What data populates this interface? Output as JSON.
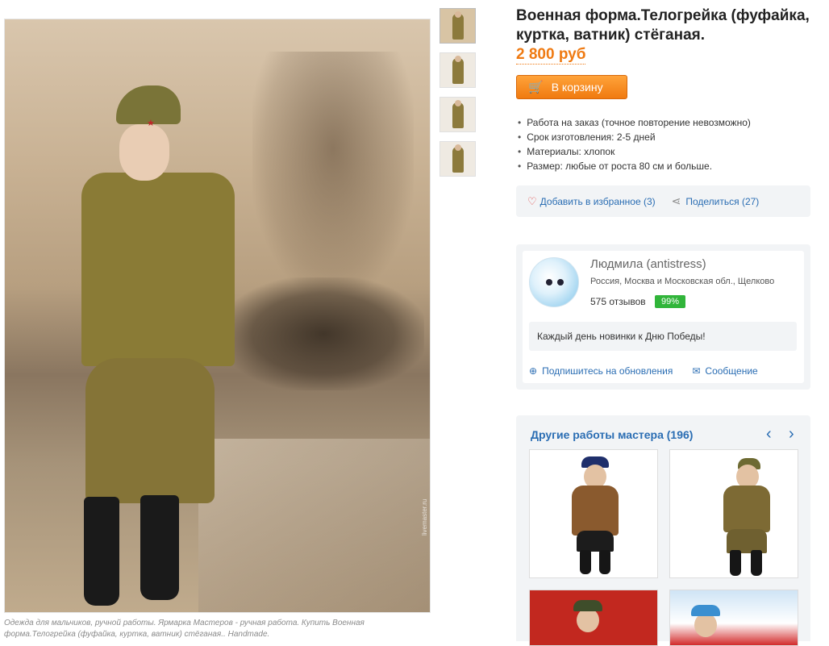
{
  "product": {
    "title": "Военная форма.Телогрейка (фуфайка, куртка, ватник) стёганая.",
    "price": "2 800 руб",
    "cart_button": "В корзину",
    "details": [
      "Работа на заказ  (точное повторение невозможно)",
      "Срок изготовления: 2-5 дней",
      "Материалы: хлопок",
      "Размер: любые от роста 80 см и больше."
    ],
    "favorite_label": "Добавить в избранное (3)",
    "share_label": "Поделиться (27)",
    "caption": "Одежда для мальчиков, ручной работы. Ярмарка Мастеров - ручная работа. Купить Военная форма.Телогрейка (фуфайка, куртка, ватник) стёганая.. Handmade.",
    "watermark": "livemaster.ru"
  },
  "seller": {
    "name": "Людмила (antistress)",
    "location": "Россия, Москва и Московская обл., Щелково",
    "reviews": "575 отзывов",
    "rating": "99%",
    "note": "Каждый день новинки к Дню Победы!",
    "subscribe": "Подпишитесь на обновления",
    "message": "Сообщение"
  },
  "others": {
    "title": "Другие работы мастера (196)",
    "prev": "‹",
    "next": "›"
  },
  "icons": {
    "cart": "cart-icon",
    "heart": "heart-icon",
    "share": "share-icon",
    "plus": "plus-circle-icon",
    "mail": "envelope-icon"
  },
  "colors": {
    "accent_orange": "#ef7a12",
    "link_blue": "#2a6db3",
    "rating_green": "#31b53a"
  }
}
